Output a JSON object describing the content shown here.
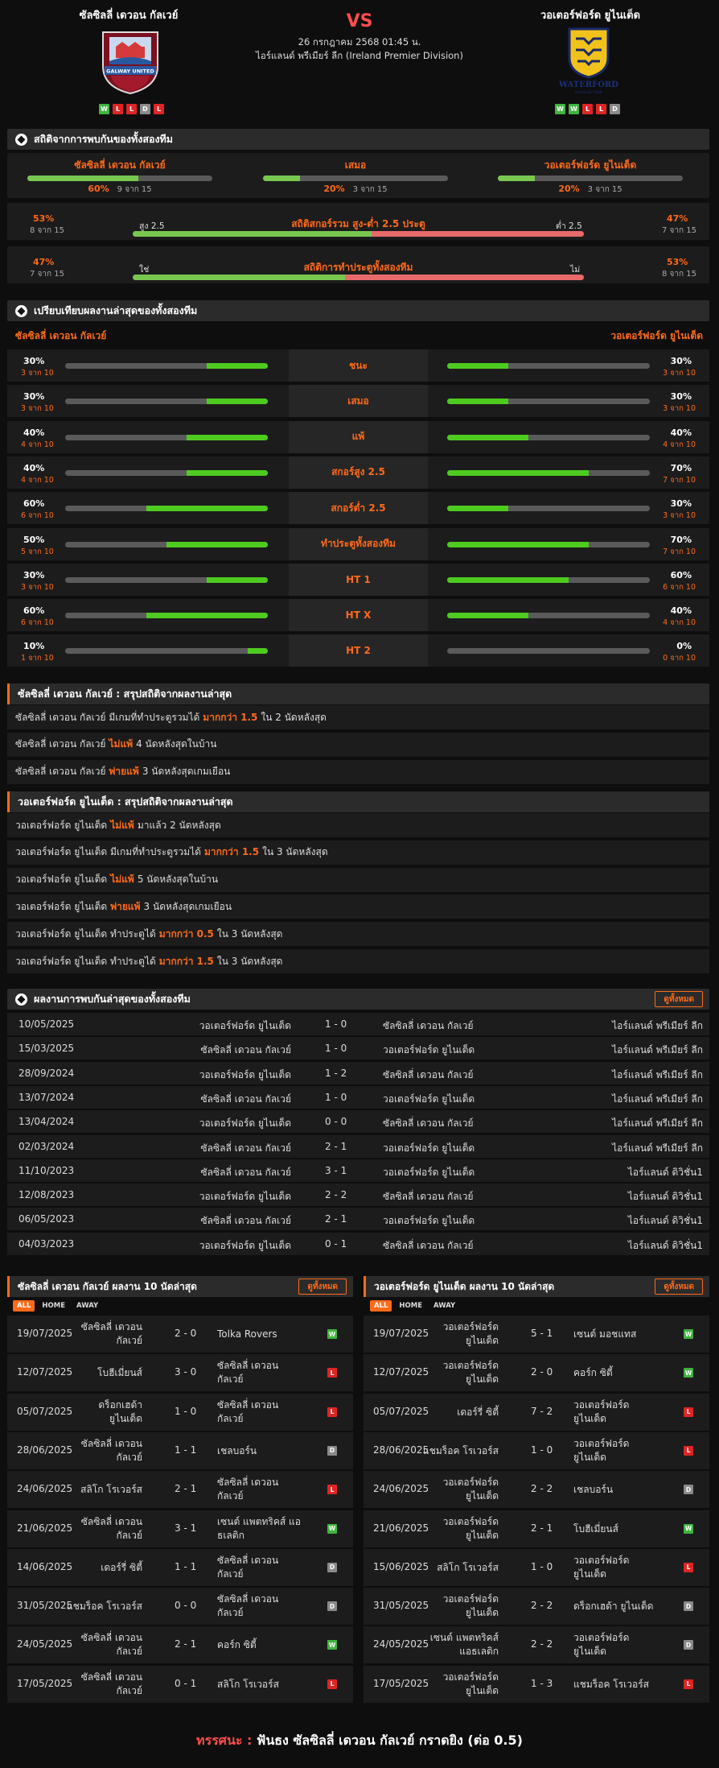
{
  "header": {
    "home_team": "ซัลซิลลี่ เดวอน กัลเวย์",
    "away_team": "วอเตอร์ฟอร์ด ยูไนเต็ด",
    "vs": "VS",
    "datetime": "26 กรกฎาคม 2568 01:45 น.",
    "league": "ไอร์แลนด์ พรีเมียร์ ลีก (Ireland Premier Division)",
    "home_logo_text": "GALWAY UNITED",
    "away_logo_text": "WATERFORD",
    "away_logo_sub": "Football Club",
    "home_form": [
      "W",
      "L",
      "L",
      "D",
      "L"
    ],
    "away_form": [
      "W",
      "W",
      "L",
      "L",
      "D"
    ]
  },
  "h2h_stats": {
    "title": "สถิติจากการพบกันของทั้งสองทีม",
    "cells": [
      {
        "label": "ซัลซิลลี่ เดวอน กัลเวย์",
        "pct": "60%",
        "sub": "9 จาก 15",
        "fill": 0.6
      },
      {
        "label": "เสมอ",
        "pct": "20%",
        "sub": "3 จาก 15",
        "fill": 0.2
      },
      {
        "label": "วอเตอร์ฟอร์ด ยูไนเต็ด",
        "pct": "20%",
        "sub": "3 จาก 15",
        "fill": 0.2
      }
    ],
    "ou": {
      "left_pct": "53%",
      "left_sub": "8 จาก 15",
      "right_pct": "47%",
      "right_sub": "7 จาก 15",
      "left_lbl": "สูง 2.5",
      "right_lbl": "ต่ำ 2.5",
      "title": "สถิติสกอร์รวม สูง-ต่ำ 2.5 ประตู",
      "fill": 0.53
    },
    "btts": {
      "left_pct": "47%",
      "left_sub": "7 จาก 15",
      "right_pct": "53%",
      "right_sub": "8 จาก 15",
      "left_lbl": "ใช่",
      "right_lbl": "ไม่",
      "title": "สถิติการทำประตูทั้งสองทีม",
      "fill": 0.47
    }
  },
  "compare": {
    "title": "เปรียบเทียบผลงานล่าสุดของทั้งสองทีม",
    "home": "ซัลซิลลี่ เดวอน กัลเวย์",
    "away": "วอเตอร์ฟอร์ด ยูไนเต็ด",
    "rows": [
      {
        "label": "ชนะ",
        "hp": "30%",
        "hs": "3 จาก 10",
        "hf": 0.3,
        "ap": "30%",
        "as": "3 จาก 10",
        "af": 0.3
      },
      {
        "label": "เสมอ",
        "hp": "30%",
        "hs": "3 จาก 10",
        "hf": 0.3,
        "ap": "30%",
        "as": "3 จาก 10",
        "af": 0.3
      },
      {
        "label": "แพ้",
        "hp": "40%",
        "hs": "4 จาก 10",
        "hf": 0.4,
        "ap": "40%",
        "as": "4 จาก 10",
        "af": 0.4
      },
      {
        "label": "สกอร์สูง 2.5",
        "hp": "40%",
        "hs": "4 จาก 10",
        "hf": 0.4,
        "ap": "70%",
        "as": "7 จาก 10",
        "af": 0.7
      },
      {
        "label": "สกอร์ต่ำ 2.5",
        "hp": "60%",
        "hs": "6 จาก 10",
        "hf": 0.6,
        "ap": "30%",
        "as": "3 จาก 10",
        "af": 0.3
      },
      {
        "label": "ทำประตูทั้งสองทีม",
        "hp": "50%",
        "hs": "5 จาก 10",
        "hf": 0.5,
        "ap": "70%",
        "as": "7 จาก 10",
        "af": 0.7
      },
      {
        "label": "HT 1",
        "hp": "30%",
        "hs": "3 จาก 10",
        "hf": 0.3,
        "ap": "60%",
        "as": "6 จาก 10",
        "af": 0.6
      },
      {
        "label": "HT X",
        "hp": "60%",
        "hs": "6 จาก 10",
        "hf": 0.6,
        "ap": "40%",
        "as": "4 จาก 10",
        "af": 0.4
      },
      {
        "label": "HT 2",
        "hp": "10%",
        "hs": "1 จาก 10",
        "hf": 0.1,
        "ap": "0%",
        "as": "0 จาก 10",
        "af": 0.0
      }
    ]
  },
  "home_summary": {
    "title": "ซัลซิลลี่ เดวอน กัลเวย์ : สรุปสถิติจากผลงานล่าสุด",
    "rows": [
      {
        "a": "ซัลซิลลี่ เดวอน กัลเวย์ มีเกมที่ทำประตูรวมได้",
        "h": "มากกว่า 1.5",
        "b": "ใน 2 นัดหลังสุด"
      },
      {
        "a": "ซัลซิลลี่ เดวอน กัลเวย์",
        "h": "ไม่แพ้",
        "b": "4 นัดหลังสุดในบ้าน"
      },
      {
        "a": "ซัลซิลลี่ เดวอน กัลเวย์",
        "h": "พ่ายแพ้",
        "b": "3 นัดหลังสุดเกมเยือน"
      }
    ]
  },
  "away_summary": {
    "title": "วอเตอร์ฟอร์ด ยูไนเต็ด : สรุปสถิติจากผลงานล่าสุด",
    "rows": [
      {
        "a": "วอเตอร์ฟอร์ด ยูไนเต็ด",
        "h": "ไม่แพ้",
        "b": "มาแล้ว 2 นัดหลังสุด"
      },
      {
        "a": "วอเตอร์ฟอร์ด ยูไนเต็ด มีเกมที่ทำประตูรวมได้",
        "h": "มากกว่า 1.5",
        "b": "ใน 3 นัดหลังสุด"
      },
      {
        "a": "วอเตอร์ฟอร์ด ยูไนเต็ด",
        "h": "ไม่แพ้",
        "b": "5 นัดหลังสุดในบ้าน"
      },
      {
        "a": "วอเตอร์ฟอร์ด ยูไนเต็ด",
        "h": "พ่ายแพ้",
        "b": "3 นัดหลังสุดเกมเยือน"
      },
      {
        "a": "วอเตอร์ฟอร์ด ยูไนเต็ด ทำประตูได้",
        "h": "มากกว่า 0.5",
        "b": "ใน 3 นัดหลังสุด"
      },
      {
        "a": "วอเตอร์ฟอร์ด ยูไนเต็ด ทำประตูได้",
        "h": "มากกว่า 1.5",
        "b": "ใน 3 นัดหลังสุด"
      }
    ]
  },
  "h2h_results": {
    "title": "ผลงานการพบกันล่าสุดของทั้งสองทีม",
    "view_all": "ดูทั้งหมด",
    "rows": [
      {
        "date": "10/05/2025",
        "home": "วอเตอร์ฟอร์ด ยูไนเต็ด",
        "score": "1 - 0",
        "away": "ซัลซิลลี่ เดวอน กัลเวย์",
        "league": "ไอร์แลนด์ พรีเมียร์ ลีก"
      },
      {
        "date": "15/03/2025",
        "home": "ซัลซิลลี่ เดวอน กัลเวย์",
        "score": "1 - 0",
        "away": "วอเตอร์ฟอร์ด ยูไนเต็ด",
        "league": "ไอร์แลนด์ พรีเมียร์ ลีก"
      },
      {
        "date": "28/09/2024",
        "home": "วอเตอร์ฟอร์ด ยูไนเต็ด",
        "score": "1 - 2",
        "away": "ซัลซิลลี่ เดวอน กัลเวย์",
        "league": "ไอร์แลนด์ พรีเมียร์ ลีก"
      },
      {
        "date": "13/07/2024",
        "home": "ซัลซิลลี่ เดวอน กัลเวย์",
        "score": "1 - 0",
        "away": "วอเตอร์ฟอร์ด ยูไนเต็ด",
        "league": "ไอร์แลนด์ พรีเมียร์ ลีก"
      },
      {
        "date": "13/04/2024",
        "home": "วอเตอร์ฟอร์ด ยูไนเต็ด",
        "score": "0 - 0",
        "away": "ซัลซิลลี่ เดวอน กัลเวย์",
        "league": "ไอร์แลนด์ พรีเมียร์ ลีก"
      },
      {
        "date": "02/03/2024",
        "home": "ซัลซิลลี่ เดวอน กัลเวย์",
        "score": "2 - 1",
        "away": "วอเตอร์ฟอร์ด ยูไนเต็ด",
        "league": "ไอร์แลนด์ พรีเมียร์ ลีก"
      },
      {
        "date": "11/10/2023",
        "home": "ซัลซิลลี่ เดวอน กัลเวย์",
        "score": "3 - 1",
        "away": "วอเตอร์ฟอร์ด ยูไนเต็ด",
        "league": "ไอร์แลนด์ ดิวิชั่น1"
      },
      {
        "date": "12/08/2023",
        "home": "วอเตอร์ฟอร์ด ยูไนเต็ด",
        "score": "2 - 2",
        "away": "ซัลซิลลี่ เดวอน กัลเวย์",
        "league": "ไอร์แลนด์ ดิวิชั่น1"
      },
      {
        "date": "06/05/2023",
        "home": "ซัลซิลลี่ เดวอน กัลเวย์",
        "score": "2 - 1",
        "away": "วอเตอร์ฟอร์ด ยูไนเต็ด",
        "league": "ไอร์แลนด์ ดิวิชั่น1"
      },
      {
        "date": "04/03/2023",
        "home": "วอเตอร์ฟอร์ด ยูไนเต็ด",
        "score": "0 - 1",
        "away": "ซัลซิลลี่ เดวอน กัลเวย์",
        "league": "ไอร์แลนด์ ดิวิชั่น1"
      }
    ]
  },
  "last10": {
    "tabs": [
      "ALL",
      "HOME",
      "AWAY"
    ],
    "view_all": "ดูทั้งหมด",
    "home": {
      "title": "ซัลซิลลี่ เดวอน กัลเวย์ ผลงาน 10 นัดล่าสุด",
      "rows": [
        {
          "date": "19/07/2025",
          "home": "ซัลซิลลี่ เดวอน กัลเวย์",
          "score": "2 - 0",
          "away": "Tolka Rovers",
          "res": "W"
        },
        {
          "date": "12/07/2025",
          "home": "โบฮีเมี่ยนส์",
          "score": "3 - 0",
          "away": "ซัลซิลลี่ เดวอน กัลเวย์",
          "res": "L"
        },
        {
          "date": "05/07/2025",
          "home": "ดร็อกเฮด้า ยูไนเต็ด",
          "score": "1 - 0",
          "away": "ซัลซิลลี่ เดวอน กัลเวย์",
          "res": "L"
        },
        {
          "date": "28/06/2025",
          "home": "ซัลซิลลี่ เดวอน กัลเวย์",
          "score": "1 - 1",
          "away": "เชลบอร์น",
          "res": "D"
        },
        {
          "date": "24/06/2025",
          "home": "สลิโก โรเวอร์ส",
          "score": "2 - 1",
          "away": "ซัลซิลลี่ เดวอน กัลเวย์",
          "res": "L"
        },
        {
          "date": "21/06/2025",
          "home": "ซัลซิลลี่ เดวอน กัลเวย์",
          "score": "3 - 1",
          "away": "เซนต์ แพตทริคส์ แอธเลติก",
          "res": "W"
        },
        {
          "date": "14/06/2025",
          "home": "เดอร์รี่ ซิตี้",
          "score": "1 - 1",
          "away": "ซัลซิลลี่ เดวอน กัลเวย์",
          "res": "D"
        },
        {
          "date": "31/05/2025",
          "home": "แชมร็อค โรเวอร์ส",
          "score": "0 - 0",
          "away": "ซัลซิลลี่ เดวอน กัลเวย์",
          "res": "D"
        },
        {
          "date": "24/05/2025",
          "home": "ซัลซิลลี่ เดวอน กัลเวย์",
          "score": "2 - 1",
          "away": "คอร์ก ซิตี้",
          "res": "W"
        },
        {
          "date": "17/05/2025",
          "home": "ซัลซิลลี่ เดวอน กัลเวย์",
          "score": "0 - 1",
          "away": "สลิโก โรเวอร์ส",
          "res": "L"
        }
      ]
    },
    "away": {
      "title": "วอเตอร์ฟอร์ด ยูไนเต็ด ผลงาน 10 นัดล่าสุด",
      "rows": [
        {
          "date": "19/07/2025",
          "home": "วอเตอร์ฟอร์ด ยูไนเต็ด",
          "score": "5 - 1",
          "away": "เซนต์ มอชแทส",
          "res": "W"
        },
        {
          "date": "12/07/2025",
          "home": "วอเตอร์ฟอร์ด ยูไนเต็ด",
          "score": "2 - 0",
          "away": "คอร์ก ซิตี้",
          "res": "W"
        },
        {
          "date": "05/07/2025",
          "home": "เดอร์รี่ ซิตี้",
          "score": "7 - 2",
          "away": "วอเตอร์ฟอร์ด ยูไนเต็ด",
          "res": "L"
        },
        {
          "date": "28/06/2025",
          "home": "แชมร็อค โรเวอร์ส",
          "score": "1 - 0",
          "away": "วอเตอร์ฟอร์ด ยูไนเต็ด",
          "res": "L"
        },
        {
          "date": "24/06/2025",
          "home": "วอเตอร์ฟอร์ด ยูไนเต็ด",
          "score": "2 - 2",
          "away": "เชลบอร์น",
          "res": "D"
        },
        {
          "date": "21/06/2025",
          "home": "วอเตอร์ฟอร์ด ยูไนเต็ด",
          "score": "2 - 1",
          "away": "โบฮีเมี่ยนส์",
          "res": "W"
        },
        {
          "date": "15/06/2025",
          "home": "สลิโก โรเวอร์ส",
          "score": "1 - 0",
          "away": "วอเตอร์ฟอร์ด ยูไนเต็ด",
          "res": "L"
        },
        {
          "date": "31/05/2025",
          "home": "วอเตอร์ฟอร์ด ยูไนเต็ด",
          "score": "2 - 2",
          "away": "ดร็อกเฮด้า ยูไนเต็ด",
          "res": "D"
        },
        {
          "date": "24/05/2025",
          "home": "เซนต์ แพตทริคส์ แอธเลติก",
          "score": "2 - 2",
          "away": "วอเตอร์ฟอร์ด ยูไนเต็ด",
          "res": "D"
        },
        {
          "date": "17/05/2025",
          "home": "วอเตอร์ฟอร์ด ยูไนเต็ด",
          "score": "1 - 3",
          "away": "แชมร็อค โรเวอร์ส",
          "res": "L"
        }
      ]
    }
  },
  "verdict": {
    "label": "ทรรศนะ :",
    "text": "ฟันธง ซัลซิลลี่ เดวอน กัลเวย์ กราดยิง (ต่อ 0.5)"
  }
}
